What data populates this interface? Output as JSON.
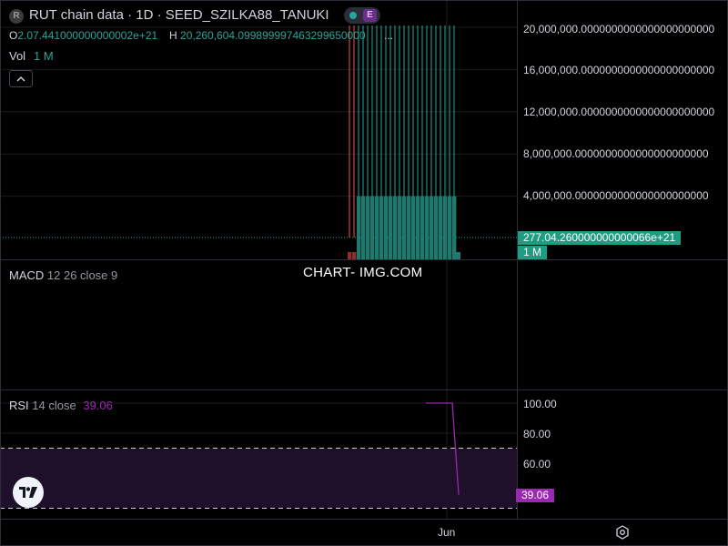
{
  "header": {
    "symbol_badge": "R",
    "title": "RUT chain data · 1D · SEED_SZILKA88_TANUKI",
    "status_badge": "E",
    "open_label": "O",
    "open_value": "2.07.441000000000002e+21",
    "high_label": "H",
    "high_value": "20,260,604.099899997463299650000",
    "ellipsis": "...",
    "volume_label": "Vol",
    "volume_value": "1 M",
    "collapse_icon": "chevron-up-icon"
  },
  "price_axis": {
    "ticks": [
      "20,000,000.0000000000000000000000",
      "16,000,000.0000000000000000000000",
      "12,000,000.0000000000000000000000",
      "8,000,000.0000000000000000000000",
      "4,000,000.0000000000000000000000"
    ],
    "last_price_tag": "277.04.260000000000066e+21",
    "volume_tag": "1 M"
  },
  "macd": {
    "label": "MACD",
    "params": "12 26 close 9"
  },
  "watermark": "CHART- IMG.COM",
  "rsi": {
    "label": "RSI",
    "params": "14 close",
    "value": "39.06",
    "ticks": [
      "100.00",
      "80.00",
      "60.00"
    ]
  },
  "time_axis": {
    "label": "Jun"
  },
  "colors": {
    "up": "#26a69a",
    "down": "#ef5350",
    "rsi_line": "#9c27b0",
    "rsi_band": "#1e0f2b",
    "last_price_tag": "#1f9d83",
    "rsi_tag": "#9c27b0"
  },
  "chart_data": [
    {
      "type": "bar",
      "title": "RUT chain data · 1D · SEED_SZILKA88_TANUKI",
      "ylim": [
        0,
        22000000
      ],
      "y_ticks": [
        4000000,
        8000000,
        12000000,
        16000000,
        20000000
      ],
      "series": [
        {
          "name": "Vol",
          "values": [
            1000000,
            1000000,
            1000000,
            1000000
          ]
        }
      ],
      "candles": {
        "up": 22,
        "down": 2,
        "high": 20260604.1
      },
      "volume_columns": {
        "up": 22,
        "down": 2,
        "value": 4000000
      }
    },
    {
      "type": "line",
      "title": "RSI",
      "ylim": [
        30,
        105
      ],
      "y_ticks": [
        60,
        80,
        100
      ],
      "bands": [
        30,
        70
      ],
      "series": [
        {
          "name": "RSI",
          "values": [
            100,
            100,
            100,
            100,
            100,
            100,
            39.06
          ]
        }
      ]
    }
  ]
}
